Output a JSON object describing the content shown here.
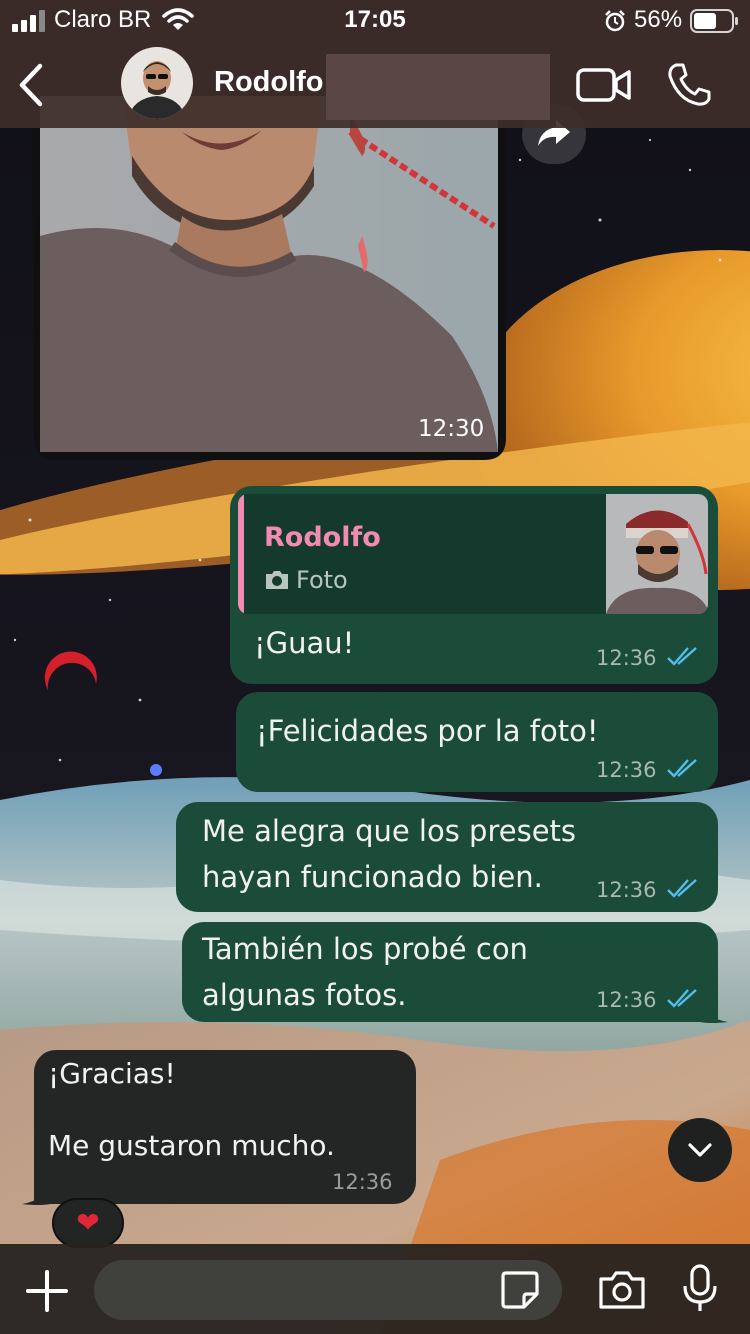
{
  "status_bar": {
    "carrier": "Claro BR",
    "time": "17:05",
    "battery_percent": "56%",
    "icons": [
      "signal-icon",
      "wifi-icon",
      "alarm-icon",
      "battery-icon"
    ]
  },
  "header": {
    "contact_name": "Rodolfo",
    "icons": [
      "back-chevron-icon",
      "video-call-icon",
      "phone-call-icon"
    ]
  },
  "messages": {
    "photo": {
      "time": "12:30"
    },
    "reply": {
      "quote_author": "Rodolfo",
      "quote_type": "Foto",
      "text": "¡Guau!",
      "time": "12:36"
    },
    "out2": {
      "text": "¡Felicidades por la foto!",
      "time": "12:36"
    },
    "out3": {
      "text": "Me alegra que los presets\nhayan funcionado bien.",
      "time": "12:36"
    },
    "out4": {
      "text": "También los probé con\nalgunas fotos.",
      "time": "12:36"
    },
    "in1": {
      "text": "¡Gracias!\n\nMe gustaron mucho.",
      "time": "12:36",
      "reaction": "❤"
    }
  },
  "input": {
    "icons": [
      "plus-icon",
      "sticker-icon",
      "camera-icon",
      "microphone-icon"
    ]
  },
  "colors": {
    "outgoing_bubble": "#1b4c39",
    "incoming_bubble": "#242626",
    "quote_accent": "#f38ab2",
    "read_ticks": "#53bdeb"
  }
}
